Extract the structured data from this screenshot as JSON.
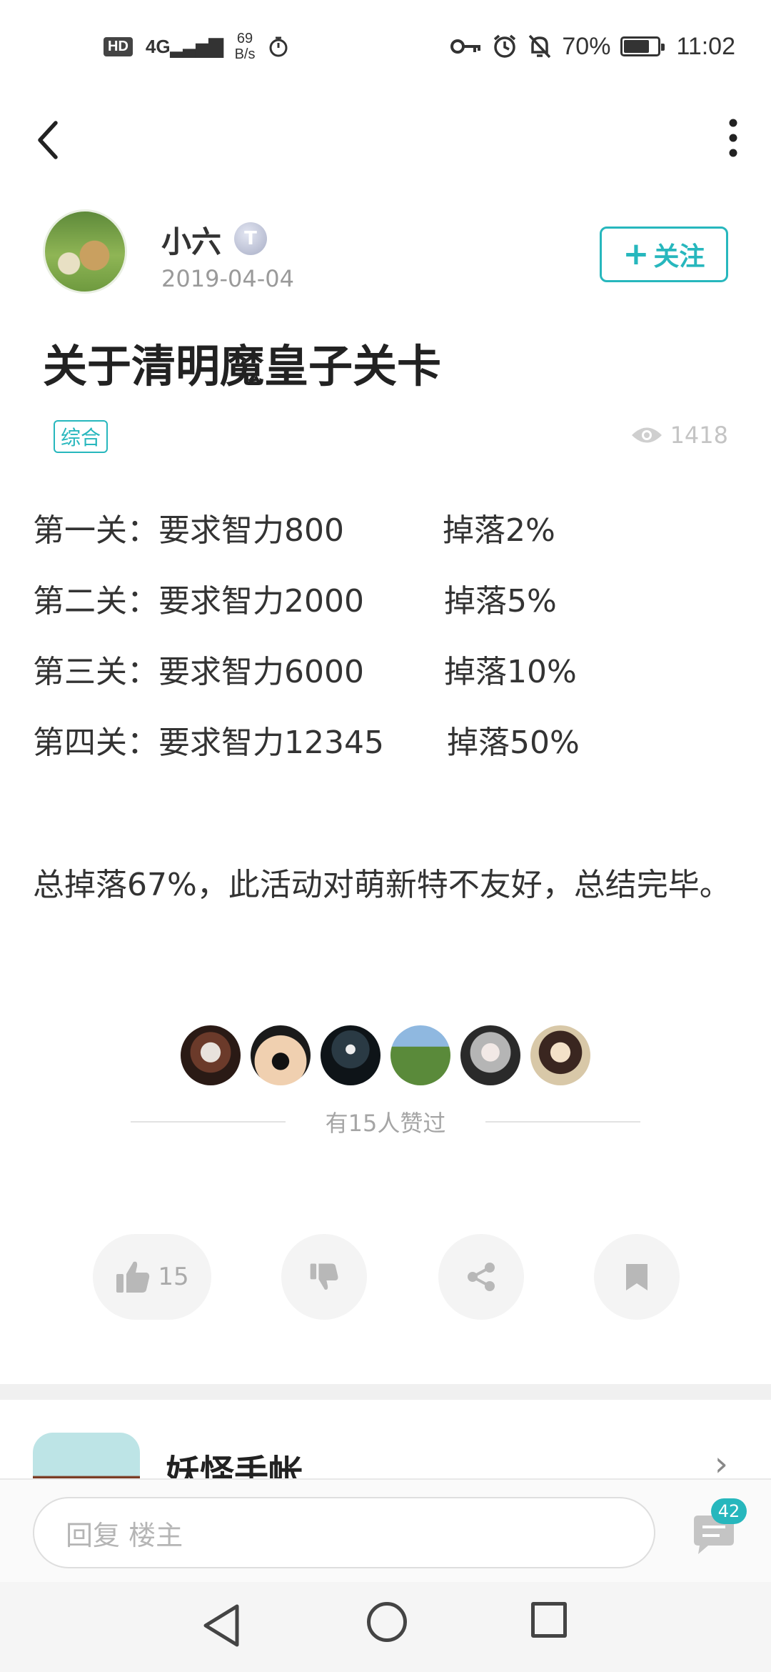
{
  "status_bar": {
    "hd": "HD",
    "signal": "4G",
    "speed_value": "69",
    "speed_unit": "B/s",
    "battery": "70%",
    "battery_level": 0.7,
    "time": "11:02"
  },
  "nav": {
    "back_icon": "back-arrow-icon",
    "more_icon": "more-vertical-icon"
  },
  "author": {
    "name": "小六",
    "badge": "T",
    "date": "2019-04-04",
    "follow_plus": "+",
    "follow_label": "关注"
  },
  "post": {
    "title": "关于清明魔皇子关卡",
    "tag": "综合",
    "views": "1418",
    "levels": [
      {
        "requirement": "第一关：要求智力800",
        "drop": "掉落2%"
      },
      {
        "requirement": "第二关：要求智力2000",
        "drop": "掉落5%"
      },
      {
        "requirement": "第三关：要求智力6000",
        "drop": "掉落10%"
      },
      {
        "requirement": "第四关：要求智力12345",
        "drop": "掉落50%"
      }
    ],
    "summary": "总掉落67%，此活动对萌新特不友好，总结完毕。"
  },
  "likes": {
    "label": "有15人赞过",
    "avatar_count": 6
  },
  "actions": {
    "like_count": "15"
  },
  "next_card": {
    "name": "妖怪手帐"
  },
  "reply": {
    "placeholder": "回复  楼主",
    "comment_count": "42"
  },
  "colors": {
    "accent": "#27b7bd",
    "muted": "#9a9a9a"
  }
}
